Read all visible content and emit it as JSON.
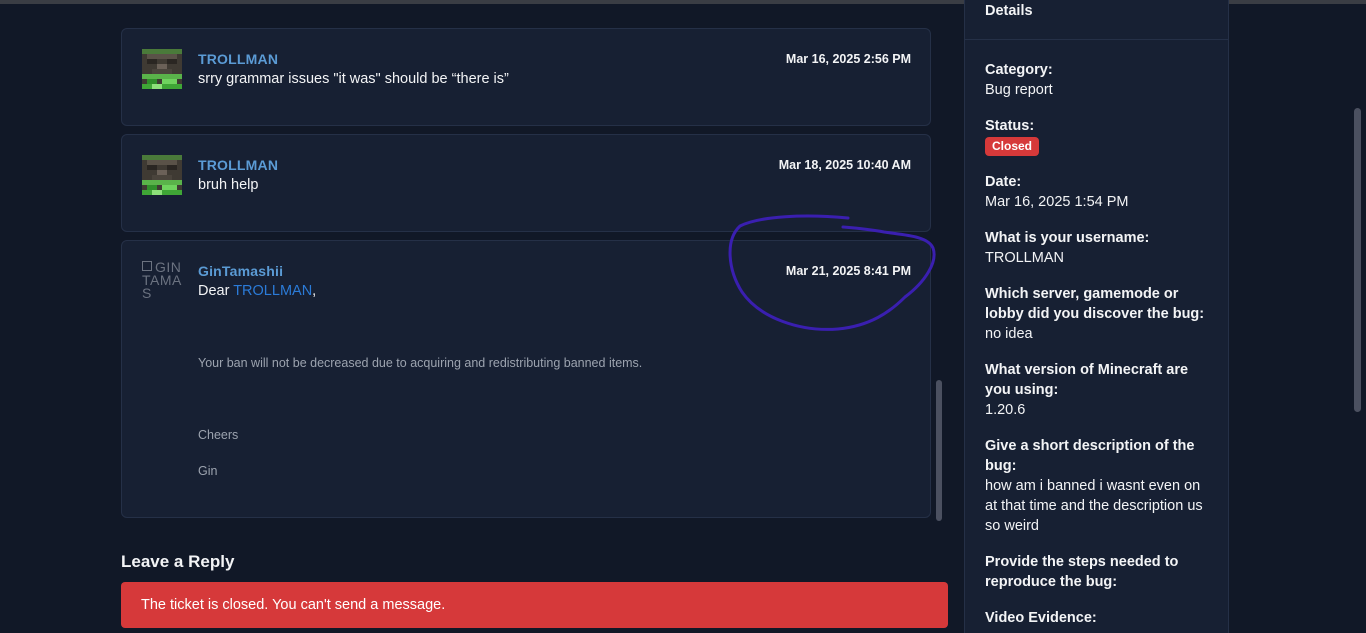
{
  "messages": [
    {
      "author": "TROLLMAN",
      "timestamp": "Mar 16, 2025 2:56 PM",
      "text": "srry grammar issues \"it was\" should be “there is”"
    },
    {
      "author": "TROLLMAN",
      "timestamp": "Mar 18, 2025 10:40 AM",
      "text": "bruh help"
    },
    {
      "author": "GinTamashii",
      "avatar_alt": "GINTAMAS",
      "timestamp": "Mar 21, 2025 8:41 PM",
      "greeting_prefix": "Dear ",
      "greeting_mention": "TROLLMAN",
      "greeting_suffix": ",",
      "line1": "Your ban will not be decreased due to acquiring and redistributing banned items.",
      "line2": "Cheers",
      "line3": "Gin"
    }
  ],
  "reply": {
    "title": "Leave a Reply",
    "closed_notice": "The ticket is closed. You can't send a message."
  },
  "details": {
    "header": "Details",
    "category_label": "Category:",
    "category_value": "Bug report",
    "status_label": "Status:",
    "status_value": "Closed",
    "date_label": "Date:",
    "date_value": "Mar 16, 2025 1:54 PM",
    "username_label": "What is your username:",
    "username_value": "TROLLMAN",
    "server_label": "Which server, gamemode or lobby did you discover the bug:",
    "server_value": "no idea",
    "version_label": "What version of Minecraft are you using:",
    "version_value": "1.20.6",
    "description_label": "Give a short description of the bug:",
    "description_value": "how am i banned i wasnt even on at that time and the description us so weird",
    "steps_label": "Provide the steps needed to reproduce the bug:",
    "video_label": "Video Evidence:"
  },
  "colors": {
    "background": "#111827",
    "card": "#172033",
    "author_link": "#5b9bd5",
    "mention": "#2b7bd8",
    "closed_red": "#d6393a",
    "annotation_ink": "#3a1fb0"
  }
}
